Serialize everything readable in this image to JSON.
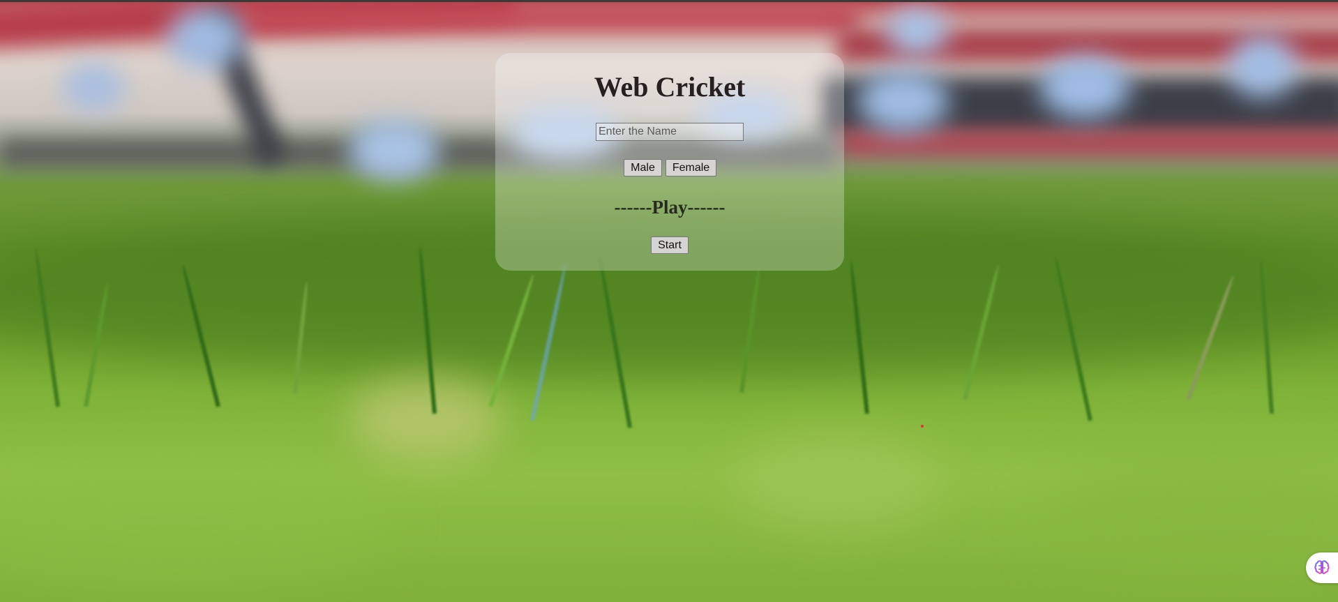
{
  "app": {
    "title": "Web Cricket"
  },
  "form": {
    "name_placeholder": "Enter the Name",
    "name_value": "",
    "gender_buttons": {
      "male_label": "Male",
      "female_label": "Female"
    },
    "play_label": "------Play------",
    "start_label": "Start"
  },
  "colors": {
    "title_text": "#262020",
    "panel_background": "rgba(255,255,255,0.28)",
    "button_background": "#d6d4d2"
  },
  "icons": {
    "assistant": "brain-icon"
  }
}
